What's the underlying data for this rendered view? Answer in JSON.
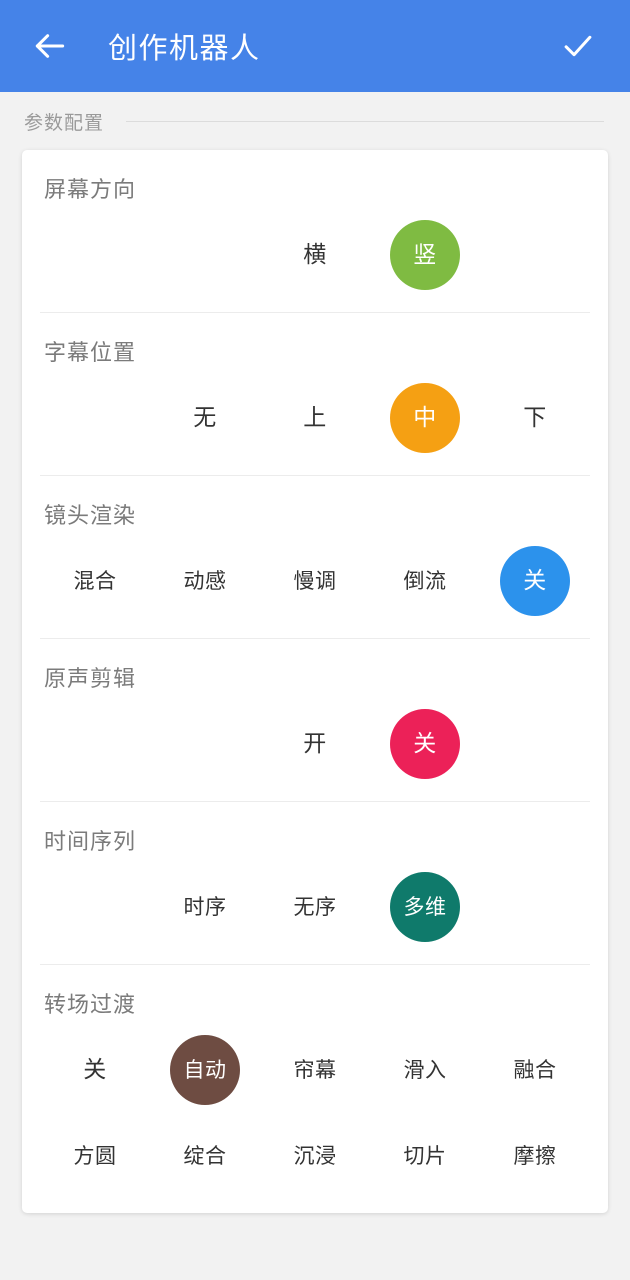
{
  "appbar": {
    "back_icon": "arrow-left-icon",
    "title": "创作机器人",
    "confirm_icon": "check-icon",
    "background_color": "#4583E8",
    "foreground_color": "#FFFFFF"
  },
  "section": {
    "label": "参数配置"
  },
  "groups": [
    {
      "title": "屏幕方向",
      "rows": [
        {
          "slots": [
            "",
            "",
            "横",
            "竖",
            ""
          ],
          "selected_index": 3
        }
      ],
      "selected_color": "#7FBB42",
      "selected_value": "竖"
    },
    {
      "title": "字幕位置",
      "rows": [
        {
          "slots": [
            "",
            "无",
            "上",
            "中",
            "下"
          ],
          "selected_index": 3
        }
      ],
      "selected_color": "#F5A013",
      "selected_value": "中"
    },
    {
      "title": "镜头渲染",
      "rows": [
        {
          "slots": [
            "混合",
            "动感",
            "慢调",
            "倒流",
            "关"
          ],
          "selected_index": 4
        }
      ],
      "selected_color": "#2C92EC",
      "selected_value": "关"
    },
    {
      "title": "原声剪辑",
      "rows": [
        {
          "slots": [
            "",
            "",
            "开",
            "关",
            ""
          ],
          "selected_index": 3
        }
      ],
      "selected_color": "#EC2158",
      "selected_value": "关"
    },
    {
      "title": "时间序列",
      "rows": [
        {
          "slots": [
            "",
            "时序",
            "无序",
            "多维",
            ""
          ],
          "selected_index": 3
        }
      ],
      "selected_color": "#0F7A6B",
      "selected_value": "多维"
    },
    {
      "title": "转场过渡",
      "rows": [
        {
          "slots": [
            "关",
            "自动",
            "帘幕",
            "滑入",
            "融合"
          ],
          "selected_index": 1
        },
        {
          "slots": [
            "方圆",
            "绽合",
            "沉浸",
            "切片",
            "摩擦"
          ],
          "selected_index": -1
        }
      ],
      "selected_color": "#6E4C42",
      "selected_value": "自动"
    }
  ]
}
